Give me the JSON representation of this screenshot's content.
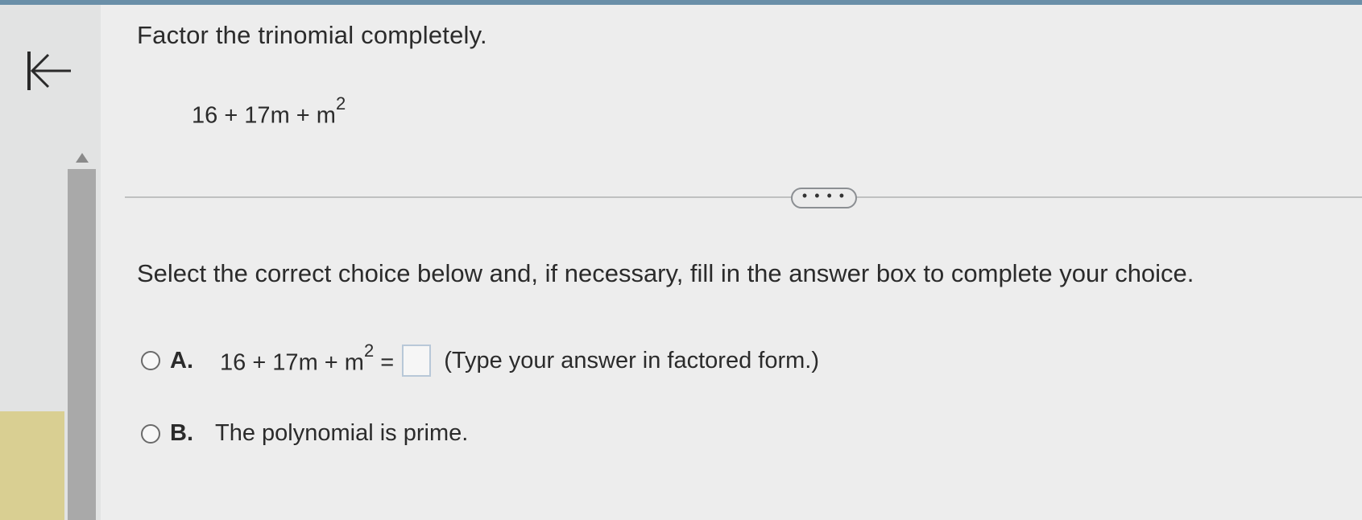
{
  "question": {
    "prompt": "Factor the trinomial completely.",
    "expression_base": "16 + 17m + m",
    "expression_exponent": "2"
  },
  "more_button": {
    "label": "• • • •"
  },
  "instruction": "Select the correct choice below and, if necessary, fill in the answer box to complete your choice.",
  "options": [
    {
      "letter": "A.",
      "expression_base": "16 + 17m + m",
      "expression_exponent": "2",
      "equals": "=",
      "answer_value": "",
      "hint": "(Type your answer in factored form.)"
    },
    {
      "letter": "B.",
      "text": "The polynomial is prime."
    }
  ],
  "icons": {
    "back": "back-to-start-icon",
    "scroll_up": "scroll-up-arrow-icon"
  }
}
